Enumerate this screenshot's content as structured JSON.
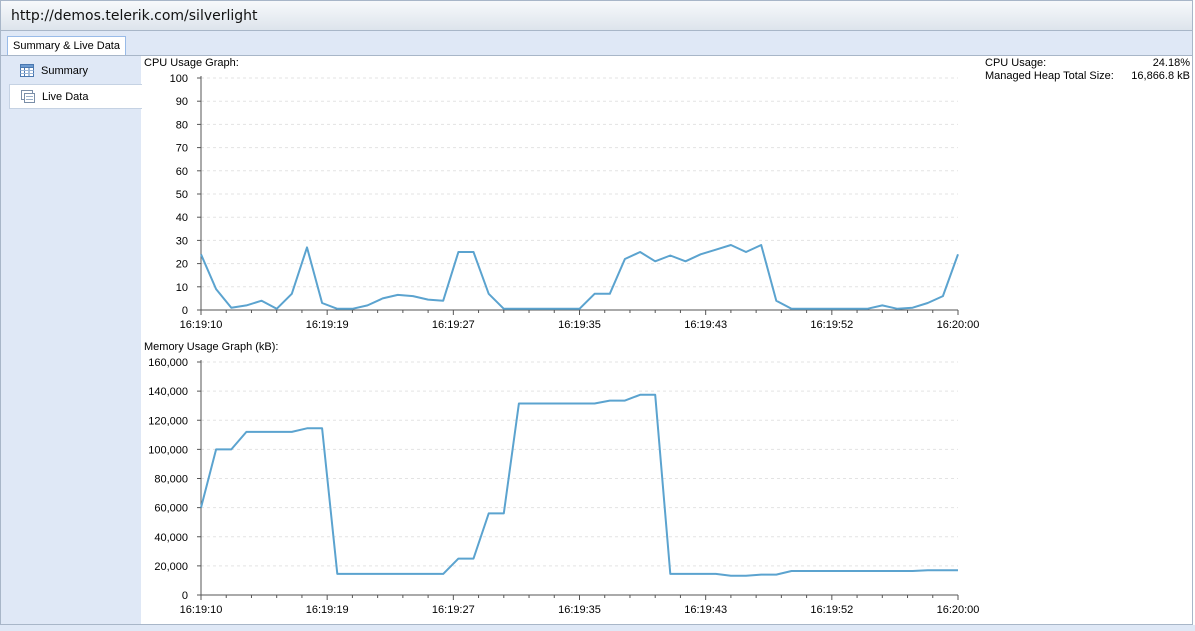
{
  "window": {
    "url": "http://demos.telerik.com/silverlight"
  },
  "tabs": [
    {
      "label": "Summary & Live Data"
    }
  ],
  "sidebar": {
    "items": [
      {
        "label": "Summary",
        "icon": "table-icon"
      },
      {
        "label": "Live Data",
        "icon": "live-data-icon",
        "selected": true
      }
    ]
  },
  "stats": [
    {
      "label": "CPU Usage:",
      "value": "24.18%"
    },
    {
      "label": "Managed Heap Total Size:",
      "value": "16,866.8 kB"
    }
  ],
  "accent": "#5ba3cf",
  "chart_data": [
    {
      "type": "line",
      "title": "CPU Usage Graph:",
      "x_tick_labels": [
        "16:19:10",
        "16:19:19",
        "16:19:27",
        "16:19:35",
        "16:19:43",
        "16:19:52",
        "16:20:00"
      ],
      "y_tick_labels": [
        "0",
        "10",
        "20",
        "30",
        "40",
        "50",
        "60",
        "70",
        "80",
        "90",
        "100"
      ],
      "ylim": [
        0,
        100
      ],
      "grid": true,
      "x_range": [
        0,
        50
      ],
      "x": [
        0,
        1,
        2,
        3,
        4,
        5,
        6,
        7,
        8,
        9,
        10,
        11,
        12,
        13,
        14,
        15,
        16,
        17,
        18,
        19,
        20,
        21,
        22,
        23,
        24,
        25,
        26,
        27,
        28,
        29,
        30,
        31,
        32,
        33,
        34,
        35,
        36,
        37,
        38,
        39,
        40,
        41,
        42,
        43,
        44,
        45,
        46,
        47,
        48,
        49,
        50
      ],
      "series": [
        {
          "values": [
            24,
            9,
            1,
            2,
            4,
            0.5,
            7,
            27,
            3,
            0.5,
            0.5,
            2,
            5,
            6.5,
            6,
            4.5,
            4,
            25,
            25,
            7,
            0.5,
            0.5,
            0.5,
            0.5,
            0.5,
            0.5,
            7,
            7,
            22,
            25,
            21,
            23.5,
            21,
            24,
            26,
            28,
            25,
            28,
            4,
            0.5,
            0.5,
            0.5,
            0.5,
            0.5,
            0.5,
            2,
            0.5,
            1,
            3,
            6,
            24
          ]
        }
      ]
    },
    {
      "type": "line",
      "title": "Memory Usage Graph (kB):",
      "x_tick_labels": [
        "16:19:10",
        "16:19:19",
        "16:19:27",
        "16:19:35",
        "16:19:43",
        "16:19:52",
        "16:20:00"
      ],
      "y_tick_labels": [
        "0",
        "20,000",
        "40,000",
        "60,000",
        "80,000",
        "100,000",
        "120,000",
        "140,000",
        "160,000"
      ],
      "ylim": [
        0,
        160000
      ],
      "grid": true,
      "x_range": [
        0,
        50
      ],
      "x": [
        0,
        1,
        2,
        3,
        4,
        5,
        6,
        7,
        8,
        9,
        10,
        11,
        12,
        13,
        14,
        15,
        16,
        17,
        18,
        19,
        20,
        21,
        22,
        23,
        24,
        25,
        26,
        27,
        28,
        29,
        30,
        31,
        32,
        33,
        34,
        35,
        36,
        37,
        38,
        39,
        40,
        41,
        42,
        43,
        44,
        45,
        46,
        47,
        48,
        49,
        50
      ],
      "series": [
        {
          "values": [
            60000,
            100000,
            100000,
            112000,
            112000,
            112000,
            112000,
            114500,
            114500,
            14500,
            14500,
            14500,
            14500,
            14500,
            14500,
            14500,
            14500,
            25000,
            25000,
            56000,
            56000,
            131500,
            131500,
            131500,
            131500,
            131500,
            131500,
            133500,
            133500,
            137500,
            137500,
            14500,
            14500,
            14500,
            14500,
            13200,
            13200,
            14000,
            14000,
            16500,
            16500,
            16500,
            16500,
            16500,
            16500,
            16500,
            16500,
            16500,
            17000,
            17000,
            17000
          ]
        }
      ]
    }
  ]
}
